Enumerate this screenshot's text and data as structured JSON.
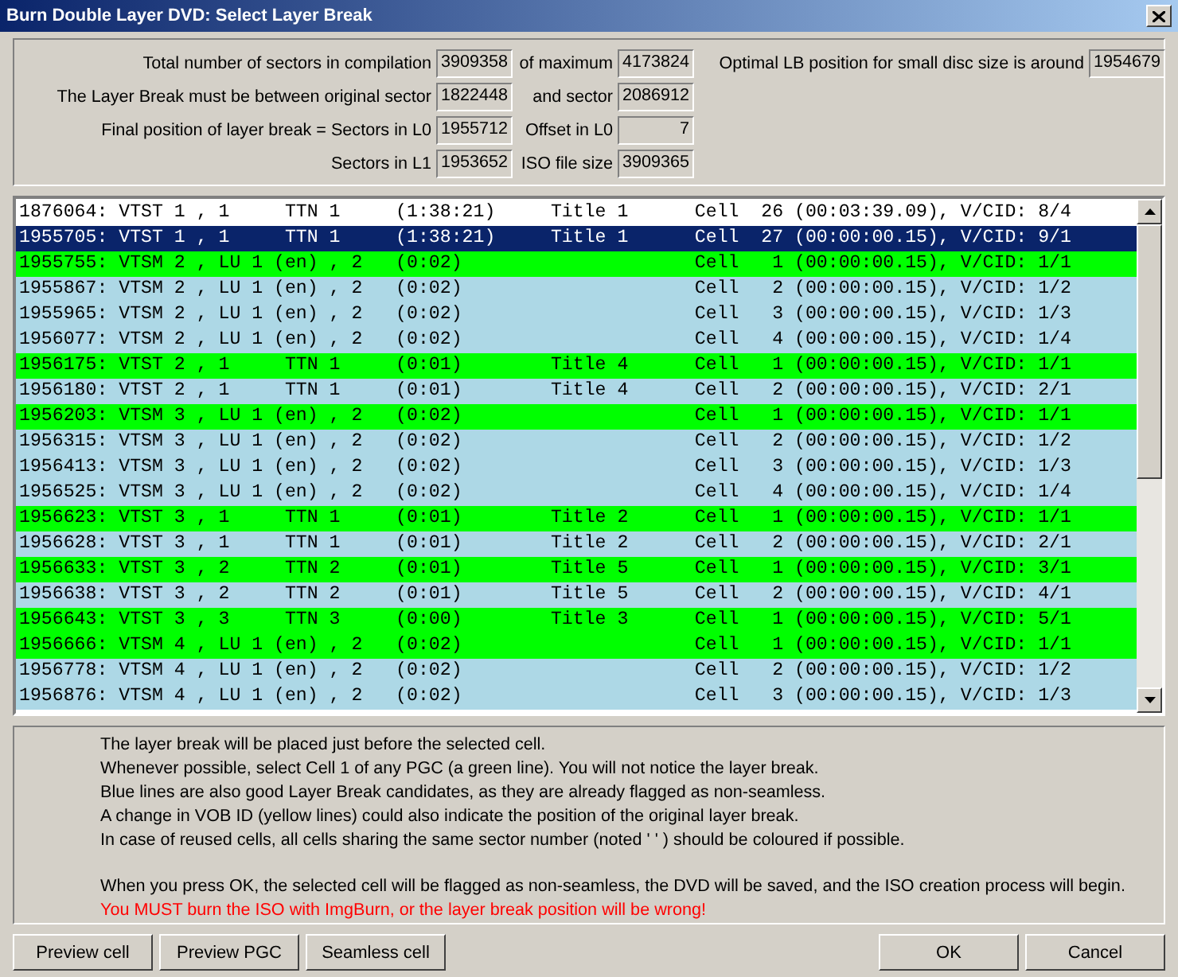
{
  "window": {
    "title": "Burn Double Layer DVD:  Select Layer Break"
  },
  "summary": {
    "rows": [
      {
        "fields": [
          {
            "label": "Total number of sectors in compilation",
            "value": "3909358"
          },
          {
            "label": "of maximum",
            "value": "4173824"
          },
          {
            "label": "Optimal LB position for small disc size is around",
            "value": "1954679"
          }
        ]
      },
      {
        "fields": [
          {
            "label": "The Layer Break must be between original sector",
            "value": "1822448"
          },
          {
            "label": "and sector",
            "value": "2086912"
          }
        ]
      },
      {
        "fields": [
          {
            "label": "Final position of layer break = Sectors in L0",
            "value": "1955712"
          },
          {
            "label": "Offset in L0",
            "value": "7"
          }
        ]
      },
      {
        "fields": [
          {
            "label": "Sectors in L1",
            "value": "1953652"
          },
          {
            "label": "ISO file size",
            "value": "3909365"
          }
        ]
      }
    ]
  },
  "cell_list": {
    "rows": [
      {
        "text": "1876064: VTST 1 , 1     TTN 1     (1:38:21)     Title 1      Cell  26 (00:03:39.09), V/CID: 8/4",
        "color": "#ffffff",
        "selected": false
      },
      {
        "text": "1955705: VTST 1 , 1     TTN 1     (1:38:21)     Title 1      Cell  27 (00:00:00.15), V/CID: 9/1",
        "color": "#0a246a",
        "selected": true
      },
      {
        "text": "1955755: VTSM 2 , LU 1 (en) , 2   (0:02)                     Cell   1 (00:00:00.15), V/CID: 1/1",
        "color": "#00ff00",
        "selected": false
      },
      {
        "text": "1955867: VTSM 2 , LU 1 (en) , 2   (0:02)                     Cell   2 (00:00:00.15), V/CID: 1/2",
        "color": "#add8e6",
        "selected": false
      },
      {
        "text": "1955965: VTSM 2 , LU 1 (en) , 2   (0:02)                     Cell   3 (00:00:00.15), V/CID: 1/3",
        "color": "#add8e6",
        "selected": false
      },
      {
        "text": "1956077: VTSM 2 , LU 1 (en) , 2   (0:02)                     Cell   4 (00:00:00.15), V/CID: 1/4",
        "color": "#add8e6",
        "selected": false
      },
      {
        "text": "1956175: VTST 2 , 1     TTN 1     (0:01)        Title 4      Cell   1 (00:00:00.15), V/CID: 1/1",
        "color": "#00ff00",
        "selected": false
      },
      {
        "text": "1956180: VTST 2 , 1     TTN 1     (0:01)        Title 4      Cell   2 (00:00:00.15), V/CID: 2/1",
        "color": "#add8e6",
        "selected": false
      },
      {
        "text": "1956203: VTSM 3 , LU 1 (en) , 2   (0:02)                     Cell   1 (00:00:00.15), V/CID: 1/1",
        "color": "#00ff00",
        "selected": false
      },
      {
        "text": "1956315: VTSM 3 , LU 1 (en) , 2   (0:02)                     Cell   2 (00:00:00.15), V/CID: 1/2",
        "color": "#add8e6",
        "selected": false
      },
      {
        "text": "1956413: VTSM 3 , LU 1 (en) , 2   (0:02)                     Cell   3 (00:00:00.15), V/CID: 1/3",
        "color": "#add8e6",
        "selected": false
      },
      {
        "text": "1956525: VTSM 3 , LU 1 (en) , 2   (0:02)                     Cell   4 (00:00:00.15), V/CID: 1/4",
        "color": "#add8e6",
        "selected": false
      },
      {
        "text": "1956623: VTST 3 , 1     TTN 1     (0:01)        Title 2      Cell   1 (00:00:00.15), V/CID: 1/1",
        "color": "#00ff00",
        "selected": false
      },
      {
        "text": "1956628: VTST 3 , 1     TTN 1     (0:01)        Title 2      Cell   2 (00:00:00.15), V/CID: 2/1",
        "color": "#add8e6",
        "selected": false
      },
      {
        "text": "1956633: VTST 3 , 2     TTN 2     (0:01)        Title 5      Cell   1 (00:00:00.15), V/CID: 3/1",
        "color": "#00ff00",
        "selected": false
      },
      {
        "text": "1956638: VTST 3 , 2     TTN 2     (0:01)        Title 5      Cell   2 (00:00:00.15), V/CID: 4/1",
        "color": "#add8e6",
        "selected": false
      },
      {
        "text": "1956643: VTST 3 , 3     TTN 3     (0:00)        Title 3      Cell   1 (00:00:00.15), V/CID: 5/1",
        "color": "#00ff00",
        "selected": false
      },
      {
        "text": "1956666: VTSM 4 , LU 1 (en) , 2   (0:02)                     Cell   1 (00:00:00.15), V/CID: 1/1",
        "color": "#00ff00",
        "selected": false
      },
      {
        "text": "1956778: VTSM 4 , LU 1 (en) , 2   (0:02)                     Cell   2 (00:00:00.15), V/CID: 1/2",
        "color": "#add8e6",
        "selected": false
      },
      {
        "text": "1956876: VTSM 4 , LU 1 (en) , 2   (0:02)                     Cell   3 (00:00:00.15), V/CID: 1/3",
        "color": "#add8e6",
        "selected": false
      }
    ]
  },
  "instructions": {
    "paragraphs": [
      [
        {
          "text": "The layer break will be placed just before the selected cell.",
          "kind": "note"
        },
        {
          "text": "Whenever possible, select Cell 1 of any PGC (a green line).  You will not notice the layer break.",
          "kind": "note"
        },
        {
          "text": "Blue lines are also good Layer Break candidates, as they are already flagged as non-seamless.",
          "kind": "note"
        },
        {
          "text": "A change in VOB ID (yellow lines) could also indicate the position of the original layer break.",
          "kind": "note"
        },
        {
          "text": "In case of reused cells, all cells sharing the same sector number (noted ' ' ) should be coloured if possible.",
          "kind": "note"
        }
      ],
      [
        {
          "text": "When you press OK, the selected cell will be flagged as non-seamless, the DVD will be saved, and the ISO creation process will begin.",
          "kind": "note"
        },
        {
          "text": "You MUST burn the ISO with ImgBurn, or the layer break position will be wrong!",
          "kind": "warning"
        }
      ]
    ]
  },
  "buttons_left": [
    "Preview cell",
    "Preview PGC",
    "Seamless cell"
  ],
  "buttons_right": [
    "OK",
    "Cancel"
  ]
}
